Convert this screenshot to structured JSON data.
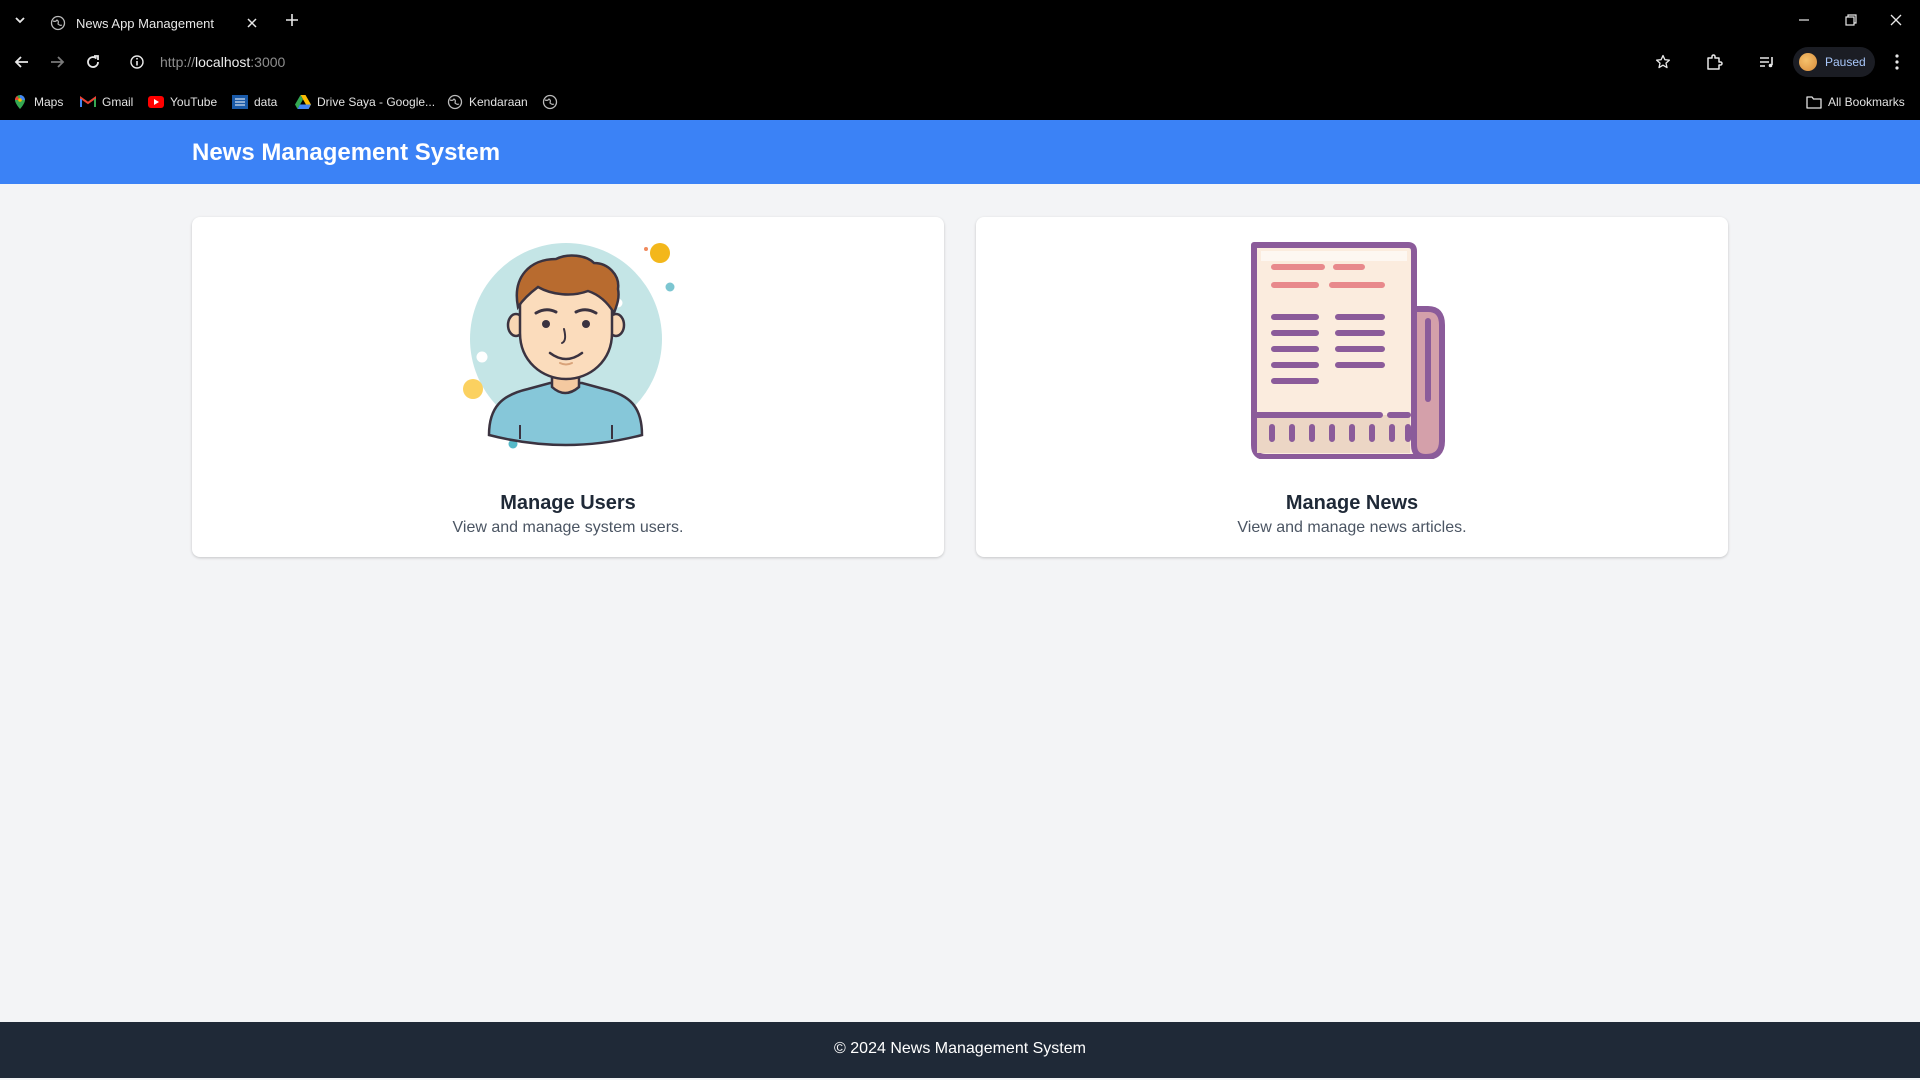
{
  "browser": {
    "tab_title": "News App Management",
    "url_scheme": "http://",
    "url_host": "localhost",
    "url_port": ":3000",
    "profile_status": "Paused",
    "bookmarks": [
      {
        "label": "Maps",
        "icon": "maps-pin-icon"
      },
      {
        "label": "Gmail",
        "icon": "gmail-icon"
      },
      {
        "label": "YouTube",
        "icon": "youtube-icon"
      },
      {
        "label": "data",
        "icon": "ieee-icon"
      },
      {
        "label": "Drive Saya - Google...",
        "icon": "google-drive-icon"
      },
      {
        "label": "Kendaraan",
        "icon": "globe-icon"
      }
    ],
    "all_bookmarks_label": "All Bookmarks"
  },
  "app": {
    "title": "News Management System",
    "accent_color": "#3b82f6",
    "footer_color": "#1f2937",
    "cards": [
      {
        "title": "Manage Users",
        "description": "View and manage system users.",
        "icon": "user-avatar-illustration"
      },
      {
        "title": "Manage News",
        "description": "View and manage news articles.",
        "icon": "newspaper-illustration"
      }
    ],
    "footer_text": "© 2024 News Management System"
  }
}
